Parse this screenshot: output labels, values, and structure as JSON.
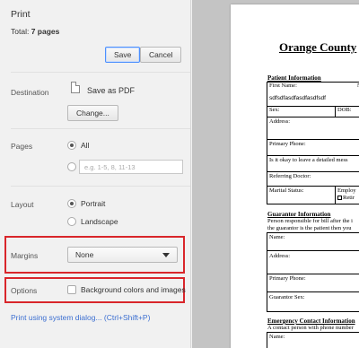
{
  "print": {
    "title": "Print",
    "total_label": "Total:",
    "total_value": "7 pages",
    "save_label": "Save",
    "cancel_label": "Cancel"
  },
  "destination": {
    "label": "Destination",
    "value": "Save as PDF",
    "change_label": "Change..."
  },
  "pages": {
    "label": "Pages",
    "all_label": "All",
    "all_selected": true,
    "range_placeholder": "e.g. 1-5, 8, 11-13"
  },
  "layout": {
    "label": "Layout",
    "portrait_label": "Portrait",
    "landscape_label": "Landscape",
    "selected": "Portrait"
  },
  "margins": {
    "label": "Margins",
    "value": "None"
  },
  "options": {
    "label": "Options",
    "background_label": "Background colors and images",
    "background_checked": false
  },
  "system_dialog_link": "Print using system dialog... (Ctrl+Shift+P)",
  "highlight_color": "#d9262b",
  "preview": {
    "title": "Orange County",
    "patient_heading": "Patient Information",
    "first_name_label": "First Name:",
    "first_name_value": "sdfsdfasdfasdfasdfsdf",
    "first_name_right": "N",
    "sex_label": "Sex:",
    "dob_label": "DOB:",
    "address_label": "Address:",
    "primary_phone_label": "Primary Phone:",
    "leave_message_label": "Is it okay to leave a detailed mess",
    "referring_label": "Referring Doctor:",
    "marital_label": "Marital Status:",
    "employ_label": "Employ",
    "retire_label": "Retir",
    "guarantor_heading": "Guarantor Information",
    "guarantor_text_1": "Person responsible for bill after the i",
    "guarantor_text_2": "the guarantor is the patient then you",
    "g_name_label": "Name:",
    "g_address_label": "Address:",
    "g_phone_label": "Primary Phone:",
    "g_sex_label": "Guarantor Sex:",
    "emergency_heading": "Emergency Contact Information",
    "emergency_text": "A contact person with phone number",
    "e_name_label": "Name:"
  }
}
